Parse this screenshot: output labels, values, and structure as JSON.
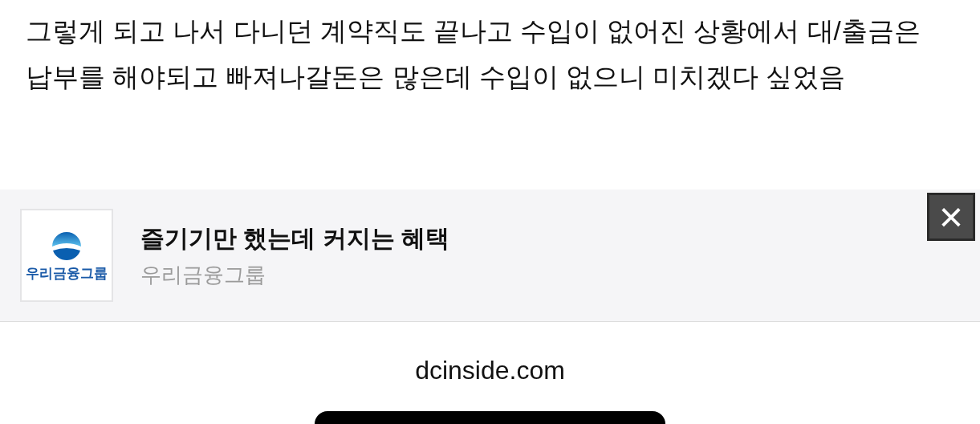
{
  "article": {
    "text": "그렇게 되고 나서 다니던 계약직도 끝나고 수입이 없어진 상황에서 대/출금은 납부를 해야되고 빠져나갈돈은 많은데 수입이 없으니 미치겠다 싶었음"
  },
  "ad": {
    "logo_text": "우리금융그룹",
    "title": "즐기기만 했는데 커지는 혜택",
    "advertiser": "우리금융그룹",
    "close": "×"
  },
  "footer": {
    "domain": "dcinside.com"
  }
}
